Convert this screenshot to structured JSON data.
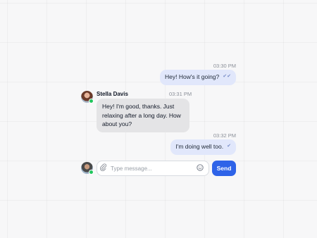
{
  "messages": [
    {
      "time": "03:30 PM",
      "text": "Hey! How's it going?",
      "status": "✔✔"
    },
    {
      "sender": "Stella Davis",
      "time": "03:31 PM",
      "lines": [
        "Hey! I'm good, thanks. Just",
        "relaxing after a long day. How",
        "about you?"
      ]
    },
    {
      "time": "03:32 PM",
      "text": "I'm doing well too.",
      "status": "✔"
    }
  ],
  "composer": {
    "placeholder": "Type message...",
    "send_label": "Send"
  },
  "colors": {
    "accent": "#2e63e8",
    "outgoing_bubble": "#e1e7fb",
    "incoming_bubble": "#e4e4e6",
    "online": "#22c55e"
  }
}
